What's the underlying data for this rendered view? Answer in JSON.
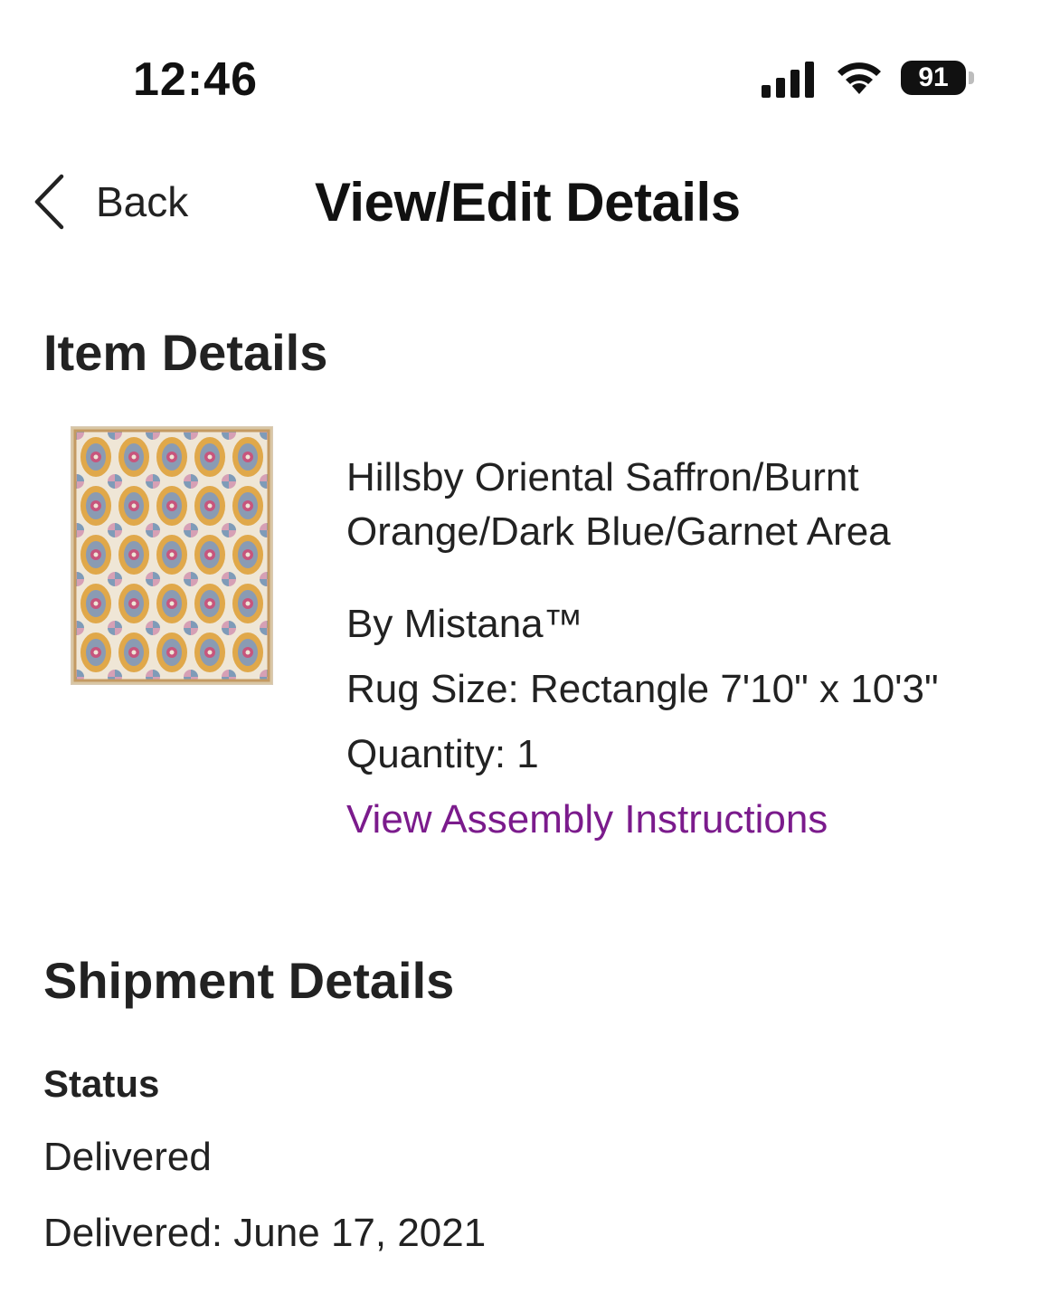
{
  "status_bar": {
    "time": "12:46",
    "battery": "91",
    "signal_icon": "cellular-signal-icon",
    "wifi_icon": "wifi-icon"
  },
  "nav": {
    "back_label": "Back",
    "back_icon": "chevron-left-icon",
    "title": "View/Edit Details"
  },
  "item_details": {
    "heading": "Item Details",
    "product_name": "Hillsby Oriental Saffron/Burnt Orange/Dark Blue/Garnet Area",
    "brand": "By Mistana™",
    "size": "Rug Size: Rectangle 7'10\" x 10'3\"",
    "quantity": "Quantity: 1",
    "assembly_link": "View Assembly Instructions"
  },
  "shipment_details": {
    "heading": "Shipment Details",
    "status_label": "Status",
    "status_value": "Delivered",
    "delivered_date": "Delivered: June 17, 2021"
  },
  "colors": {
    "link": "#7b1b8c",
    "text": "#222222"
  }
}
